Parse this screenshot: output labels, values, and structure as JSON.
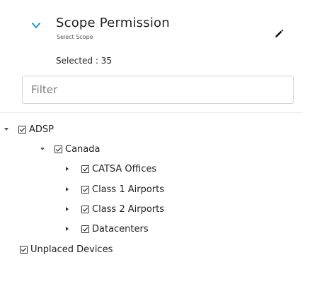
{
  "header": {
    "title": "Scope Permission",
    "subtitle": "Select Scope",
    "selected_text": "Selected : 35"
  },
  "filter": {
    "placeholder": "Filter",
    "value": ""
  },
  "tree": {
    "root": {
      "label": "ADSP",
      "expanded": true,
      "checked": true
    },
    "canada": {
      "label": "Canada",
      "expanded": true,
      "checked": true
    },
    "children": [
      {
        "label": "CATSA Offices",
        "expanded": false,
        "checked": true
      },
      {
        "label": "Class 1 Airports",
        "expanded": false,
        "checked": true
      },
      {
        "label": "Class 2 Airports",
        "expanded": false,
        "checked": true
      },
      {
        "label": "Datacenters",
        "expanded": false,
        "checked": true
      }
    ],
    "unplaced": {
      "label": "Unplaced Devices",
      "checked": true
    }
  },
  "colors": {
    "accent": "#1a9ad6",
    "text": "#222222",
    "border": "#d4d4d4"
  }
}
